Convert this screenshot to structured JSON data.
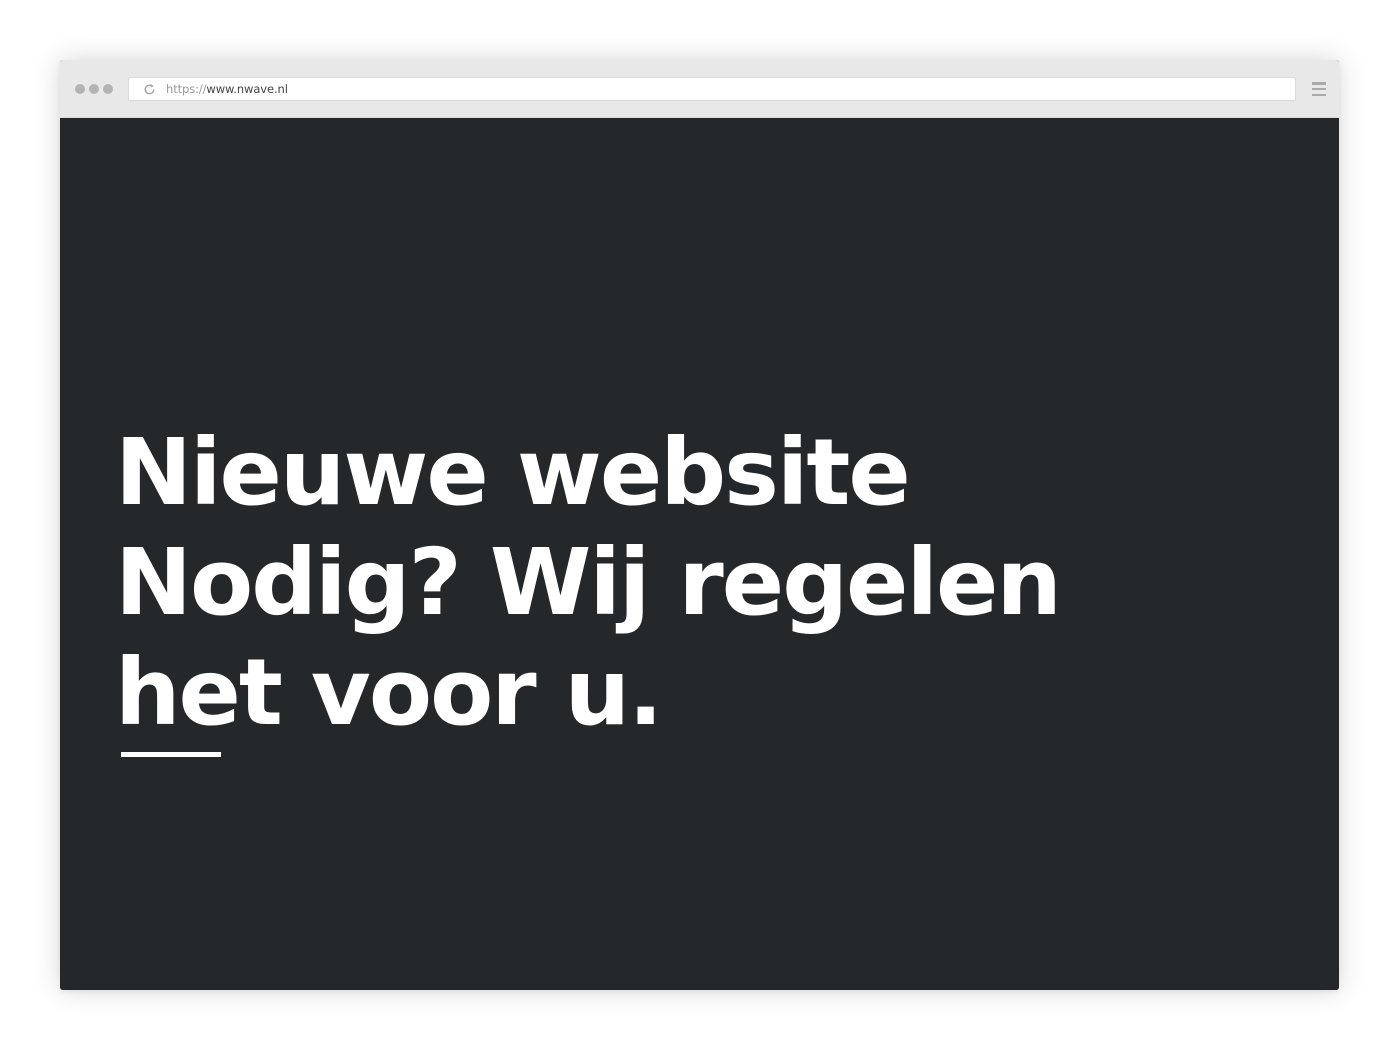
{
  "browser": {
    "address": {
      "scheme": "https://",
      "host": "www.nwave.nl"
    },
    "icons": {
      "window_controls": "traffic-light-dots",
      "reload": "reload-icon",
      "menu": "hamburger-menu-icon"
    }
  },
  "page": {
    "background_color": "#24282a",
    "text_color": "#ffffff",
    "hero": {
      "lines": [
        "Nieuwe website",
        "Nodig? Wij regelen",
        "het voor u."
      ]
    }
  }
}
